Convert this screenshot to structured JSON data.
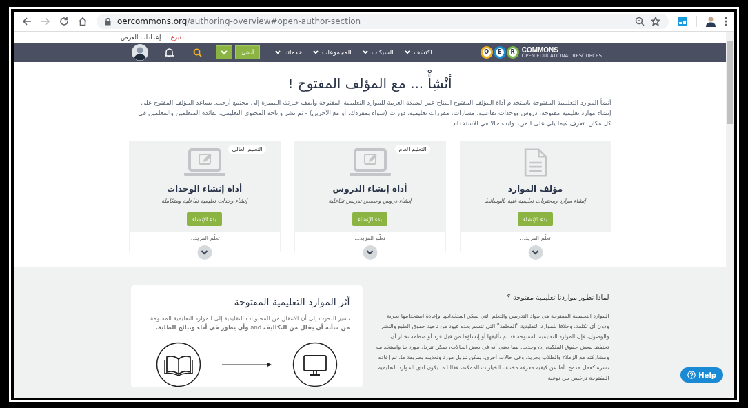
{
  "browser": {
    "url_domain": "oercommons.org",
    "url_path": "/authoring-overview#open-author-section"
  },
  "top_links": [
    {
      "label": "تبرع",
      "kind": "donate"
    },
    {
      "label": "إعدادات العرض",
      "kind": "plain"
    }
  ],
  "nav": {
    "logo_mark": "O E R",
    "logo_word": "COMMONS",
    "logo_tagline": "OPEN EDUCATIONAL RESOURCES",
    "menu": [
      {
        "label": "اكتشف"
      },
      {
        "label": "الشبكات"
      },
      {
        "label": "المجموعات"
      },
      {
        "label": "خدماتنا"
      }
    ],
    "create_button": "أنشئ"
  },
  "hero": {
    "title": "أنْشِأْ ... مع المؤلف المفتوح !",
    "intro": "أنشأ الموارد التعليمية المفتوحة باستخدام أداة المؤلف المفتوح المتاح عبر الشبكة العربية للموارد التعليمية المفتوحة وأضف خبرتك المميزة إلى مجتمع أرحب. يساعد المؤلف المفتوح على إنشاء موارد تعليمية مفتوحة، دروس ووحدات تفاعلية، مسارات، مقررات تعليمية، دورات (سواء بمفردك، أو مع الآخرين) - ثم نشر وإتاحة المحتوى التعليمي، لفائدة المتعلمين والمعلمين في كل مكان. تعرف فيما يلي على المزيد وابدء حالا في الاستخدام."
  },
  "tools": [
    {
      "kind": "document",
      "title": "مؤلف الموارد",
      "subtitle": "إنشاء موارد ومحتويات تعليمية غنية بالوسائط",
      "button": "بدء الإنشاء",
      "more": "تعلّم المزيد..."
    },
    {
      "kind": "laptop",
      "badge": "التعليم العام",
      "title": "أداة إنشاء الدروس",
      "subtitle": "إنشاء دروس وحصص تدريس تفاعلية",
      "button": "بدء الإنشاء",
      "more": "تعلّم المزيد..."
    },
    {
      "kind": "laptop",
      "badge": "التعليم العالي",
      "title": "أداة إنشاء الوحدات",
      "subtitle": "إنشاء وحدات تعليمية تفاعلية ومتكاملة",
      "button": "بدء الإنشاء",
      "more": "تعلّم المزيد..."
    }
  ],
  "why": {
    "title": "لماذا نطور مواردنا تعليمية مفتوحة ؟",
    "text": "الموارد التعليمية المفتوحة هي مواد التدريس والتعلم التي يمكن استخدامها وإعادة استخدامها بحرية ودون أي تكلفة. وخلافا للموارد التقليدية \"المغلقة\" التي تتسم بعدة قيود من ناحية حقوق الطبع والنشر والوصول، فإن الموارد التعليمية المفتوحة قد تم تأليفها أو إنشاؤها من قبل فرد أو منظمة تختار أن تحتفظ ببعض حقوق الملكية، إن وجدت. مما يعني أنه في بعض الحالات، يمكن تنزيل مورد ما واستخدامه ومشاركته مع الزملاء والطلاب بحرية. وفي حالات أخرى، يمكن تنزيل مورد وتعديله بطريقة ما، ثم إعادة نشره كعمل مدمج. أما عن كيفية معرفة مختلف الخيارات الممكنة، فغالبا ما يكون لدى الموارد التعليمية المفتوحة ترخيص من نوعية"
  },
  "impact": {
    "title": "أثر الموارد التعليمية المفتوحة",
    "text": "تشير البحوث إلى أن الانتقال من المحتويات التقليدية إلى الموارد التعليمية المفتوحة **من شأنه أن يقلل من التكاليف** and **وأن يطور في أداء ونتائج الطلبة.**"
  },
  "help_button": "Help"
}
